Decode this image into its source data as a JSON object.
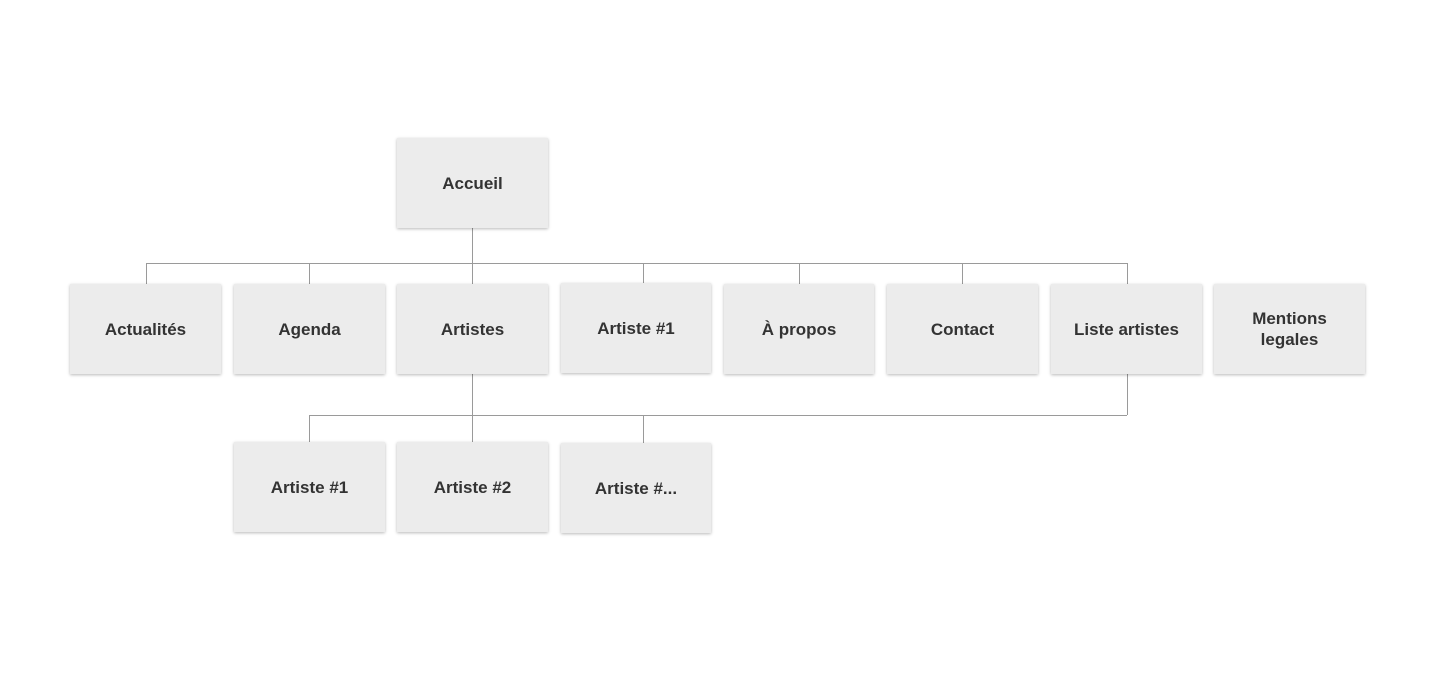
{
  "sitemap": {
    "root": {
      "label": "Accueil"
    },
    "level1": [
      {
        "label": "Actualités"
      },
      {
        "label": "Agenda"
      },
      {
        "label": "Artistes"
      },
      {
        "label": "Artiste #1"
      },
      {
        "label": "À propos"
      },
      {
        "label": "Contact"
      },
      {
        "label": "Liste artistes"
      },
      {
        "label": "Mentions\nlegales"
      }
    ],
    "level2": [
      {
        "label": "Artiste #1"
      },
      {
        "label": "Artiste #2"
      },
      {
        "label": "Artiste #..."
      }
    ]
  },
  "colors": {
    "node_fill": "#ececec",
    "node_text": "#333333",
    "connector": "#9a9a9a",
    "background": "#ffffff"
  }
}
